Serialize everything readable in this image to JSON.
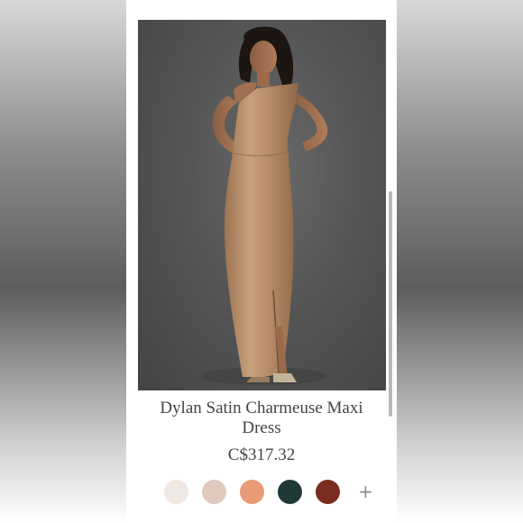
{
  "product": {
    "title": "Dylan Satin Charmeuse Maxi Dress",
    "price": "C$317.32",
    "image_alt_icon": "product-photo"
  },
  "swatches": [
    {
      "name": "ivory",
      "color": "#ede8e3"
    },
    {
      "name": "blush",
      "color": "#e0c8bd"
    },
    {
      "name": "apricot",
      "color": "#e99a77"
    },
    {
      "name": "dark-green",
      "color": "#1f3a36"
    },
    {
      "name": "rust",
      "color": "#7b2c21"
    }
  ],
  "more_swatches": "+",
  "colors": {
    "background_blur": "#8a8a8a",
    "text": "#444444",
    "dress": "#b98e68"
  }
}
